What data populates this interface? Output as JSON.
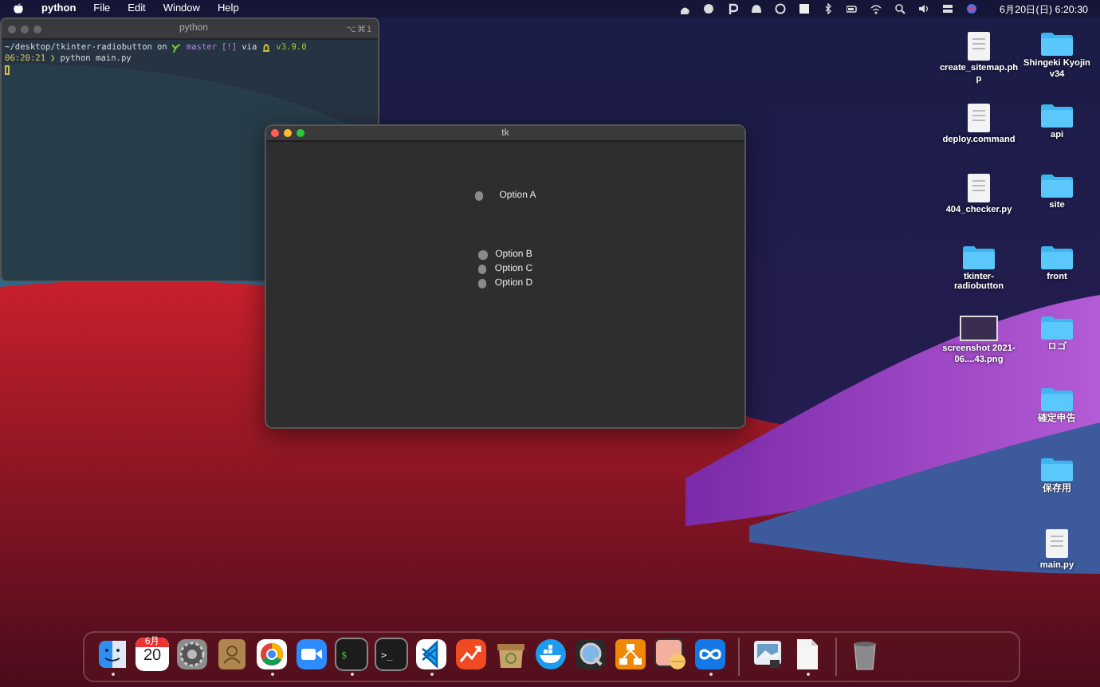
{
  "menu_bar": {
    "app_name": "python",
    "menus": [
      "File",
      "Edit",
      "Window",
      "Help"
    ],
    "clock": "6月20日(日)  6:20:30"
  },
  "terminal": {
    "title": "python",
    "shortcut": "⌥⌘1",
    "lines": [
      {
        "kind": "prompt",
        "path": "~/desktop/tkinter-radiobutton",
        "on": "on",
        "branch": "master",
        "status": "[!]",
        "via": "via",
        "version": "v3.9.0"
      },
      {
        "kind": "command",
        "time": "06:20:21",
        "arrow": "❯",
        "command": "python main.py"
      }
    ]
  },
  "tk_window": {
    "title": "tk",
    "radios": [
      {
        "label": "Option A",
        "selected": false
      },
      {
        "label": "Option B",
        "selected": false
      },
      {
        "label": "Option C",
        "selected": false
      },
      {
        "label": "Option D",
        "selected": false
      }
    ]
  },
  "desktop_icons_left": [
    {
      "kind": "file",
      "label": "create_sitemap.ph p"
    },
    {
      "kind": "file",
      "label": "deploy.command"
    },
    {
      "kind": "file",
      "label": "404_checker.py"
    },
    {
      "kind": "folder",
      "label": "tkinter-radiobutton"
    },
    {
      "kind": "image",
      "label": "screenshot 2021-06....43.png"
    }
  ],
  "desktop_icons_right": [
    {
      "kind": "folder",
      "label": "Shingeki Kyojin v34"
    },
    {
      "kind": "folder",
      "label": "api"
    },
    {
      "kind": "folder",
      "label": "site"
    },
    {
      "kind": "folder",
      "label": "front"
    },
    {
      "kind": "folder",
      "label": "ロゴ"
    },
    {
      "kind": "folder",
      "label": "確定申告"
    },
    {
      "kind": "folder",
      "label": "保存用"
    },
    {
      "kind": "file",
      "label": "main.py"
    }
  ],
  "dock": [
    {
      "kind": "finder",
      "running": true
    },
    {
      "kind": "calendar",
      "month": "6月",
      "day": "20",
      "running": false
    },
    {
      "kind": "settings",
      "running": false
    },
    {
      "kind": "contacts",
      "running": false
    },
    {
      "kind": "chrome",
      "running": true
    },
    {
      "kind": "zoom",
      "running": false
    },
    {
      "kind": "terminal",
      "glyph": "$",
      "running": true
    },
    {
      "kind": "terminal",
      "glyph": ">_",
      "running": false
    },
    {
      "kind": "vscode",
      "running": true
    },
    {
      "kind": "chart",
      "running": false
    },
    {
      "kind": "archive",
      "running": false
    },
    {
      "kind": "docker",
      "running": false
    },
    {
      "kind": "quicktime",
      "running": false
    },
    {
      "kind": "diagram",
      "running": false
    },
    {
      "kind": "preview",
      "running": false
    },
    {
      "kind": "infinity",
      "running": true
    },
    {
      "kind": "separator"
    },
    {
      "kind": "photo",
      "running": false
    },
    {
      "kind": "document",
      "running": true
    },
    {
      "kind": "separator"
    },
    {
      "kind": "trash",
      "running": false
    }
  ]
}
